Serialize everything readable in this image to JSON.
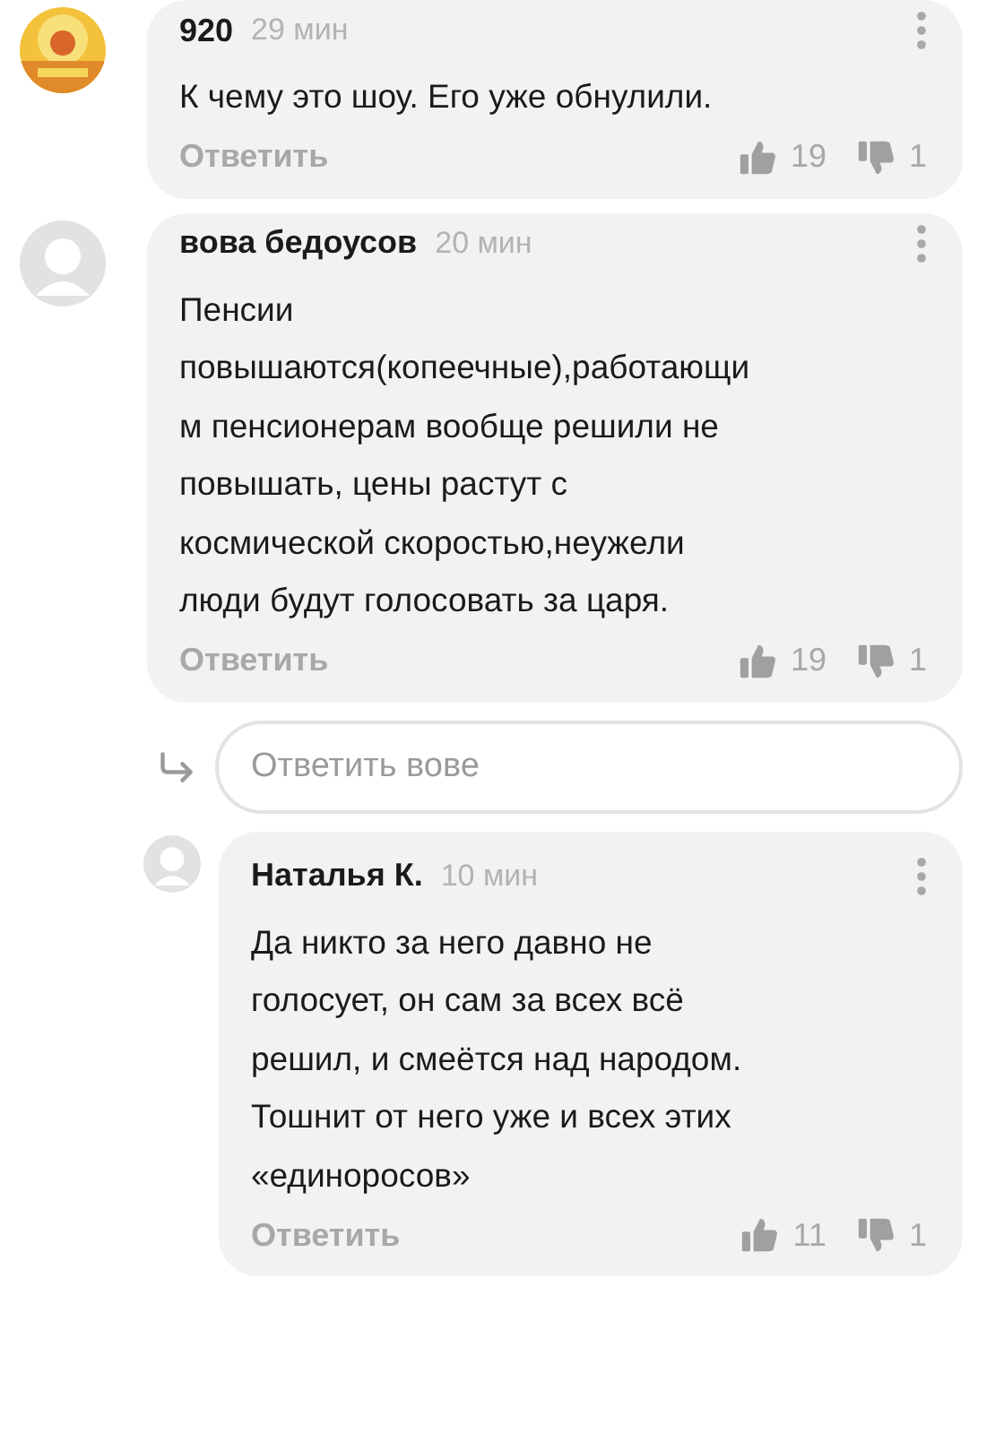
{
  "comments": [
    {
      "author": "920",
      "time": "29 мин",
      "avatar": {
        "kind": "picture"
      },
      "lines": [
        "К чему это шоу. Его уже обнулили."
      ],
      "reply_label": "Ответить",
      "likes": "19",
      "dislikes": "1"
    },
    {
      "author": "вова бедоусов",
      "time": "20 мин",
      "avatar": {
        "kind": "default"
      },
      "lines": [
        "Пенсии",
        "повышаются(копеечные),работающи",
        "м пенсионерам вообще решили не",
        "повышать, цены растут с",
        "космической скоростью,неужели",
        "люди будут голосовать за царя."
      ],
      "reply_label": "Ответить",
      "likes": "19",
      "dislikes": "1",
      "reply_box": {
        "placeholder": "Ответить вове"
      },
      "children": [
        {
          "author": "Наталья К.",
          "time": "10 мин",
          "avatar": {
            "kind": "default"
          },
          "lines": [
            "Да никто за него давно не",
            "голосует, он сам за всех всё",
            "решил, и смеётся над народом.",
            "Тошнит от него уже и всех этих",
            "«единоросов»"
          ],
          "reply_label": "Ответить",
          "likes": "11",
          "dislikes": "1"
        }
      ]
    }
  ]
}
